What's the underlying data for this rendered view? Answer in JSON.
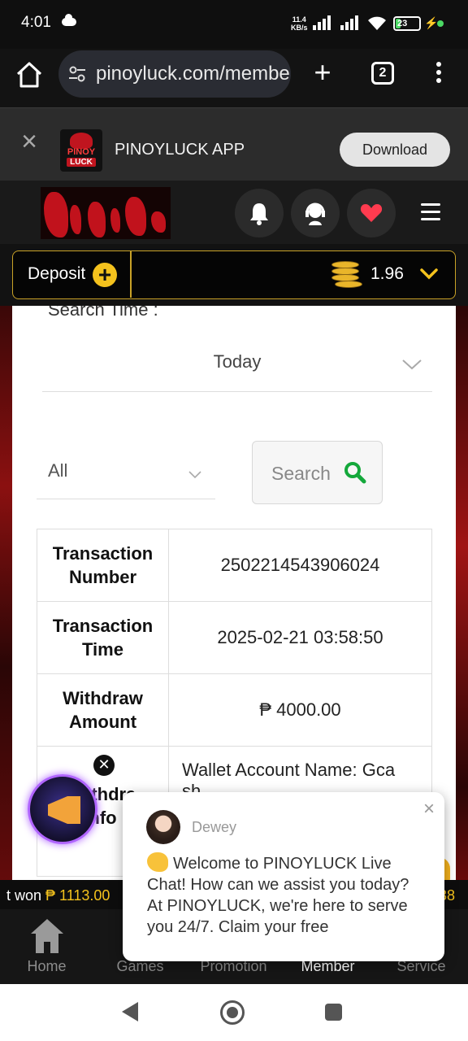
{
  "status_bar": {
    "time": "4:01",
    "net_speed_value": "11.4",
    "net_speed_unit": "KB/s",
    "battery": "23"
  },
  "browser": {
    "url": "pinoyluck.com/membe",
    "tab_count": "2"
  },
  "app_banner": {
    "logo_top": "PINOY",
    "logo_bottom": "LUCK",
    "app_name": "PINOYLUCK APP",
    "download_label": "Download"
  },
  "wallet": {
    "deposit_label": "Deposit",
    "balance": "1.96"
  },
  "filters": {
    "search_time_label": "Search Time :",
    "date_value": "Today",
    "type_value": "All",
    "search_label": "Search"
  },
  "transaction": {
    "rows": [
      {
        "label_line1": "Transaction",
        "label_line2": "Number",
        "value": "2502214543906024"
      },
      {
        "label_line1": "Transaction",
        "label_line2": "Time",
        "value": "2025-02-21 03:58:50"
      },
      {
        "label_line1": "Withdraw",
        "label_line2": "Amount",
        "value": "₱ 4000.00"
      }
    ],
    "info_label_line1": "Withdra",
    "info_label_line2": "nfo",
    "wallet_account_line1": "Wallet Account Name: Gca",
    "wallet_account_line2": "sh"
  },
  "ticker": {
    "prefix": "t won",
    "amount": "₱ 1113.00",
    "right_fragment": "38"
  },
  "bottom_nav": {
    "items": [
      {
        "label": "Home"
      },
      {
        "label": "Games"
      },
      {
        "label": "Promotion"
      },
      {
        "label": "Member"
      },
      {
        "label": "Service"
      }
    ]
  },
  "chat": {
    "agent_name": "Dewey",
    "message": "Welcome to PINOYLUCK Live Chat! How can we assist you today? At PINOYLUCK, we're here to serve you 24/7. Claim your free"
  },
  "colors": {
    "gold": "#c9a227",
    "accent_yellow": "#f4c21d",
    "search_green": "#14a83b",
    "heart_red": "#ff3b4f"
  }
}
